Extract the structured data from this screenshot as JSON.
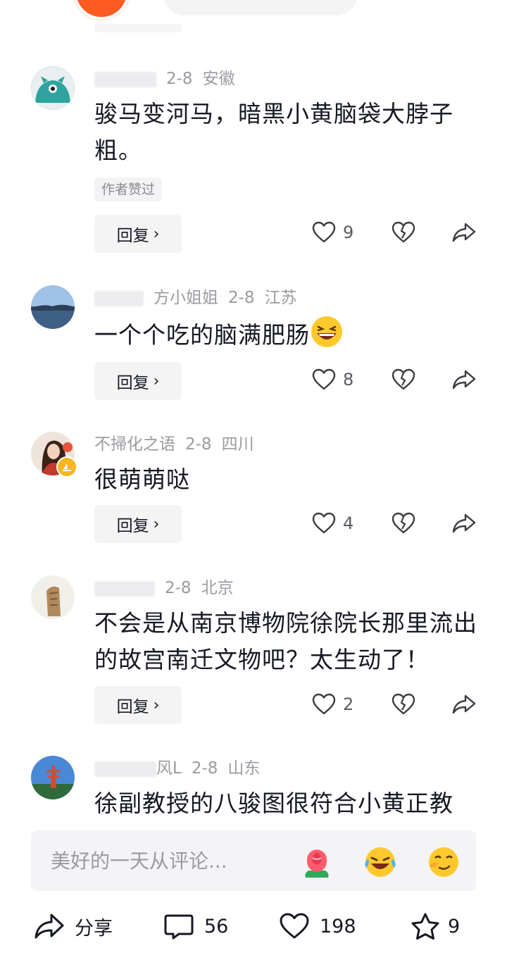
{
  "comments": [
    {
      "name_visible": "",
      "date": "2-8",
      "location": "安徽",
      "text": "骏马变河马，暗黑小黄脑袋大脖子粗。",
      "badge": "作者赞过",
      "reply_label": "回复",
      "likes": "9"
    },
    {
      "name_visible": "方小姐姐",
      "date": "2-8",
      "location": "江苏",
      "text": "一个个吃的脑满肥肠",
      "reply_label": "回复",
      "likes": "8"
    },
    {
      "name_visible": "不掃化之语",
      "date": "2-8",
      "location": "四川",
      "text": "很萌萌哒",
      "reply_label": "回复",
      "likes": "4"
    },
    {
      "name_visible": "",
      "date": "2-8",
      "location": "北京",
      "text": "不会是从南京博物院徐院长那里流出的故宫南迁文物吧？太生动了！",
      "reply_label": "回复",
      "likes": "2"
    },
    {
      "name_visible": "风L",
      "date": "2-8",
      "location": "山东",
      "text": "徐副教授的八骏图很符合小黄正教"
    }
  ],
  "input": {
    "placeholder": "美好的一天从评论..."
  },
  "quick_emojis": [
    "rose-emoji",
    "laugh-cry-emoji",
    "smirk-emoji"
  ],
  "bottom_bar": {
    "share_label": "分享",
    "comments_count": "56",
    "likes_count": "198",
    "favorites_count": "9"
  },
  "icons": {
    "heart": "heart-outline-icon",
    "broken_heart": "broken-heart-icon",
    "share": "share-arrow-icon",
    "comment": "comment-bubble-icon",
    "star": "star-outline-icon"
  },
  "colors": {
    "text": "#161823",
    "meta": "#9a9aa0",
    "chip_bg": "#f4f4f5"
  }
}
